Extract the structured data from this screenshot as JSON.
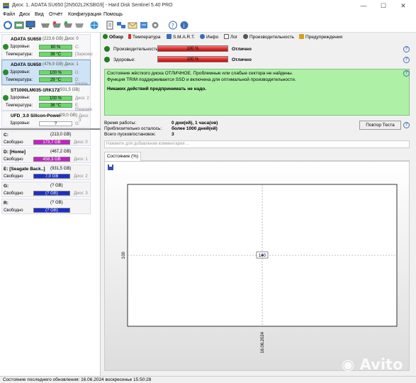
{
  "window": {
    "title": "Диск: 1, ADATA SU650 [2N502L2KSBG9]  -  Hard Disk Sentinel 5.40 PRO",
    "controls": [
      "—",
      "☐",
      "✕"
    ]
  },
  "menu": [
    "Файл",
    "Диск",
    "Вид",
    "Отчёт",
    "Конфигурация",
    "Помощь"
  ],
  "disks": [
    {
      "name": "ADATA SU650",
      "size": "(223,6 GB)",
      "disk": "Диск: 0",
      "health_label": "Здоровье:",
      "health": "80 %",
      "health_value": 80,
      "temp_label": "Температура:",
      "temp": "38 °C",
      "side1": "C:",
      "side2": "[Зарезер"
    },
    {
      "name": "ADATA SU650",
      "size": "(476,9 GB)",
      "disk": "Диск: 1",
      "health_label": "Здоровье:",
      "health": "100 %",
      "health_value": 100,
      "temp_label": "Температура:",
      "temp": "29 °C",
      "side1": "D:",
      "side2": "D: [Home"
    },
    {
      "name": "ST1000LM035-1RK172",
      "size": "(931,5 GB)",
      "disk": "",
      "health_label": "Здоровье:",
      "health": "100 %",
      "health_value": 100,
      "temp_label": "Температура:",
      "temp": "36 °C",
      "side1": "Диск: 2",
      "side2": "E: [Seagate"
    },
    {
      "name": "UFD_3.0 Silicon-Power",
      "size": "(29,0 GB)",
      "disk": "Диск: 3",
      "health_label": "Здоровье:",
      "health": "?",
      "health_value": 0,
      "temp_label": "",
      "temp": "",
      "side1": "G:",
      "side2": ""
    }
  ],
  "partitions": [
    {
      "name": "C:",
      "size": "(213,0 GB)",
      "free_label": "Свободно",
      "free": "173,7 GB",
      "disk": "Диск: 0",
      "color": "#c81fc8"
    },
    {
      "name": "D: [Home]",
      "size": "(467,2 GB)",
      "free_label": "Свободно",
      "free": "458,3 GB",
      "disk": "Диск: 1",
      "color": "#c81fc8"
    },
    {
      "name": "E: [Seagate Back..]",
      "size": "(931,5 GB)",
      "free_label": "Свободно",
      "free": "7,0 GB",
      "disk": "Диск: 2",
      "color": "#1a2fcc"
    },
    {
      "name": "G:",
      "size": "(? GB)",
      "free_label": "Свободно",
      "free": "(? GB)",
      "disk": "Диск: 3",
      "color": "#1a2fcc"
    },
    {
      "name": "R:",
      "size": "(? GB)",
      "free_label": "Свободно",
      "free": "(? GB)",
      "disk": "",
      "color": "#1a2fcc"
    }
  ],
  "tabs": [
    "Обзор",
    "Температура",
    "S.M.A.R.T.",
    "Инфо",
    "Лог",
    "Производительность",
    "Предупреждения"
  ],
  "performance": {
    "label": "Производительность:",
    "value": "100 %",
    "value_num": 100,
    "status": "Отлично"
  },
  "health": {
    "label": "Здоровье:",
    "value": "100 %",
    "value_num": 100,
    "status": "Отлично"
  },
  "message": {
    "line1": "Состояние жёсткого диска ОТЛИЧНОЕ. Проблемные или слабые сектора не найдены.",
    "line2": "Функция TRIM поддерживается SSD и включена для оптимальной производительности.",
    "line3": "Никаких действий предпринимать не надо."
  },
  "info": [
    {
      "label": "Время работы:",
      "value": "0 дни(ей), 1 часа(ов)"
    },
    {
      "label": "Приблизительно осталось:",
      "value": "более 1000 дней(ей)"
    },
    {
      "label": "Всего пусков/остановок:",
      "value": "3"
    }
  ],
  "retest_button": "Повтор Теста",
  "comment_placeholder": "Нажмите для добавления комментария ...",
  "subtab": "Состояние (%)",
  "chart_data": {
    "type": "line",
    "x": [
      "16.06.2024"
    ],
    "series": [
      {
        "values": [
          100
        ]
      }
    ],
    "ylabel": "",
    "ytick": "100",
    "xtick": "16.06.2024",
    "data_label": "100",
    "grid": true
  },
  "status": "Состояние последнего обновления: 16.06.2024 воскресенье 15:50:28",
  "watermark": "Avito"
}
